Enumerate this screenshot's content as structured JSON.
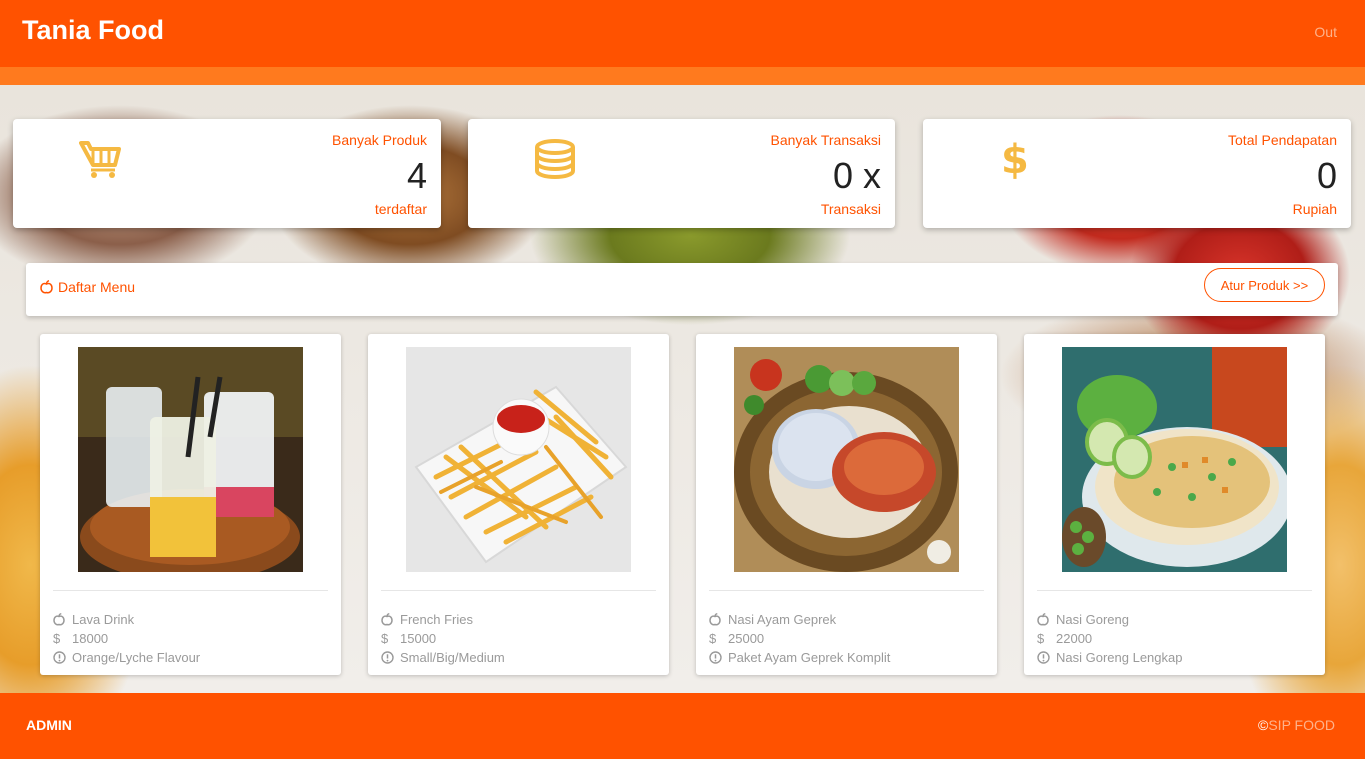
{
  "navbar": {
    "brand": "Tania Food",
    "logout_label": "Out"
  },
  "colors": {
    "primary": "#ff5200",
    "accent_bar": "#ff7a1e",
    "icon_yellow": "#f5b942"
  },
  "stats": [
    {
      "label": "Banyak Produk",
      "value": "4",
      "sub": "terdaftar",
      "icon": "cart-icon"
    },
    {
      "label": "Banyak Transaksi",
      "value": "0 x",
      "sub": "Transaksi",
      "icon": "coins-icon"
    },
    {
      "label": "Total Pendapatan",
      "value": "0",
      "sub": "Rupiah",
      "icon": "dollar-icon"
    }
  ],
  "menu": {
    "title": "Daftar Menu",
    "title_icon": "apple-icon",
    "manage_button": "Atur Produk >>"
  },
  "products": [
    {
      "name": "Lava Drink",
      "price": "18000",
      "desc": "Orange/Lyche Flavour",
      "image": "drinks-photo"
    },
    {
      "name": "French Fries",
      "price": "15000",
      "desc": "Small/Big/Medium",
      "image": "fries-photo"
    },
    {
      "name": "Nasi Ayam Geprek",
      "price": "25000",
      "desc": "Paket Ayam Geprek Komplit",
      "image": "chicken-rice-photo"
    },
    {
      "name": "Nasi Goreng",
      "price": "22000",
      "desc": "Nasi Goreng Lengkap",
      "image": "fried-rice-photo"
    }
  ],
  "footer": {
    "left": "ADMIN",
    "copyright_symbol": "©",
    "right": "SIP FOOD"
  }
}
